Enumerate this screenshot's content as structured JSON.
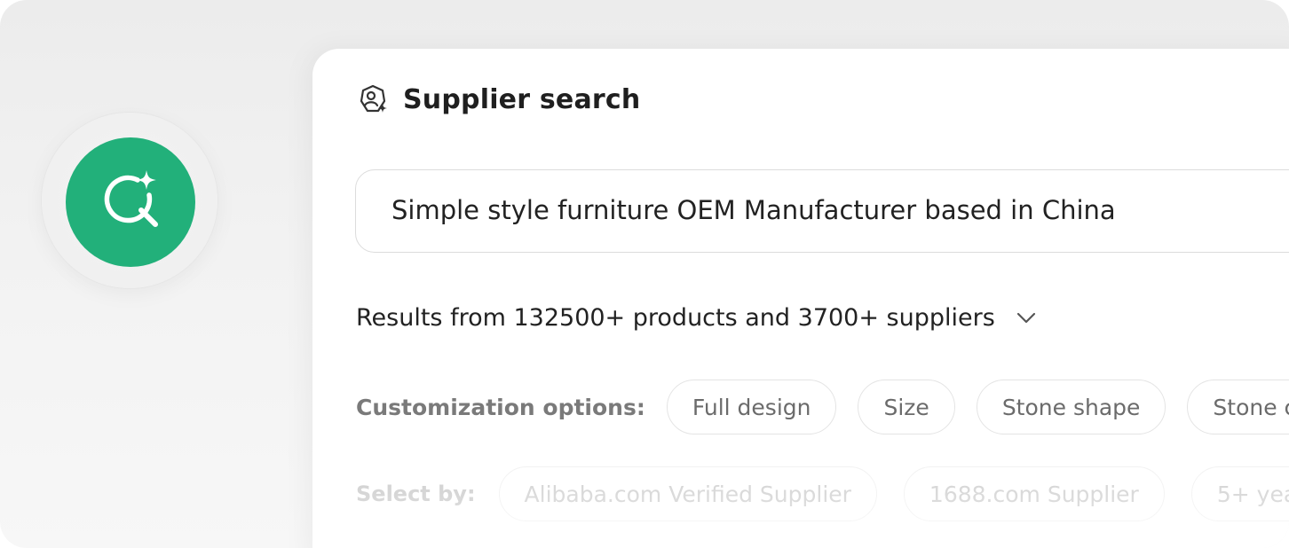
{
  "header": {
    "title": "Supplier search",
    "title_icon": "supplier-sparkle-icon"
  },
  "badge": {
    "icon": "ai-search-sparkle-icon",
    "color": "#22b07a"
  },
  "search": {
    "value": "Simple style furniture OEM Manufacturer based in China"
  },
  "results": {
    "summary": "Results from 132500+ products and 3700+ suppliers",
    "toggle_icon": "chevron-down-icon"
  },
  "customization": {
    "label": "Customization options:",
    "options": [
      "Full design",
      "Size",
      "Stone shape",
      "Stone c"
    ]
  },
  "select_by": {
    "label": "Select by:",
    "options": [
      "Alibaba.com Verified Supplier",
      "1688.com Supplier",
      "5+ yea"
    ]
  }
}
